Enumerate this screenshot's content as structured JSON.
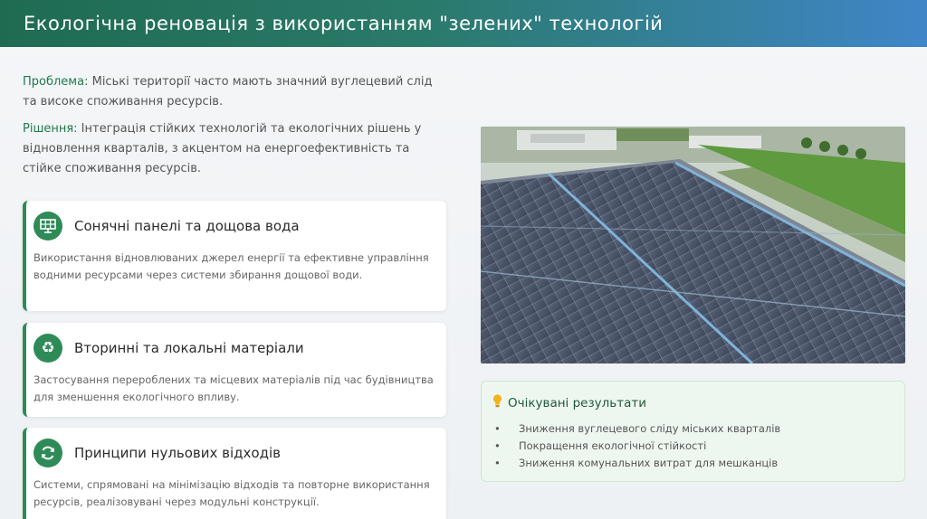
{
  "header": {
    "title": "Екологічна реновація з використанням \"зелених\" технологій"
  },
  "intro": {
    "problem_label": "Проблема:",
    "problem_text": " Міські території часто мають значний вуглецевий слід та високе споживання ресурсів.",
    "solution_label": "Рішення:",
    "solution_text": " Інтеграція стійких технологій та екологічних рішень у відновлення кварталів, з акцентом на енергоефективність та стійке споживання ресурсів."
  },
  "cards": [
    {
      "icon": "solar-panel-icon",
      "title": "Сонячні панелі та дощова вода",
      "desc": "Використання відновлюваних джерел енергії та ефективне управління водними ресурсами через системи збирання дощової води."
    },
    {
      "icon": "recycle-icon",
      "title": "Вторинні та локальні матеріали",
      "desc": "Застосування перероблених та місцевих матеріалів під час будівництва для зменшення екологічного впливу."
    },
    {
      "icon": "refresh-icon",
      "title": "Принципи нульових відходів",
      "desc": "Системи, спрямовані на мінімізацію відходів та повторне використання ресурсів, реалізовувані через модульні конструкції."
    }
  ],
  "results": {
    "icon": "lightbulb-icon",
    "title": "Очікувані результати",
    "bullet": "•",
    "items": [
      "Зниження вуглецевого сліду міських кварталів",
      "Покращення екологічної стійкості",
      "Зниження комунальних витрат для мешканців"
    ]
  },
  "colors": {
    "accent": "#2e8b57",
    "header_start": "#1f6b52",
    "header_end": "#3f86c8",
    "results_bg": "#eef7ef"
  }
}
